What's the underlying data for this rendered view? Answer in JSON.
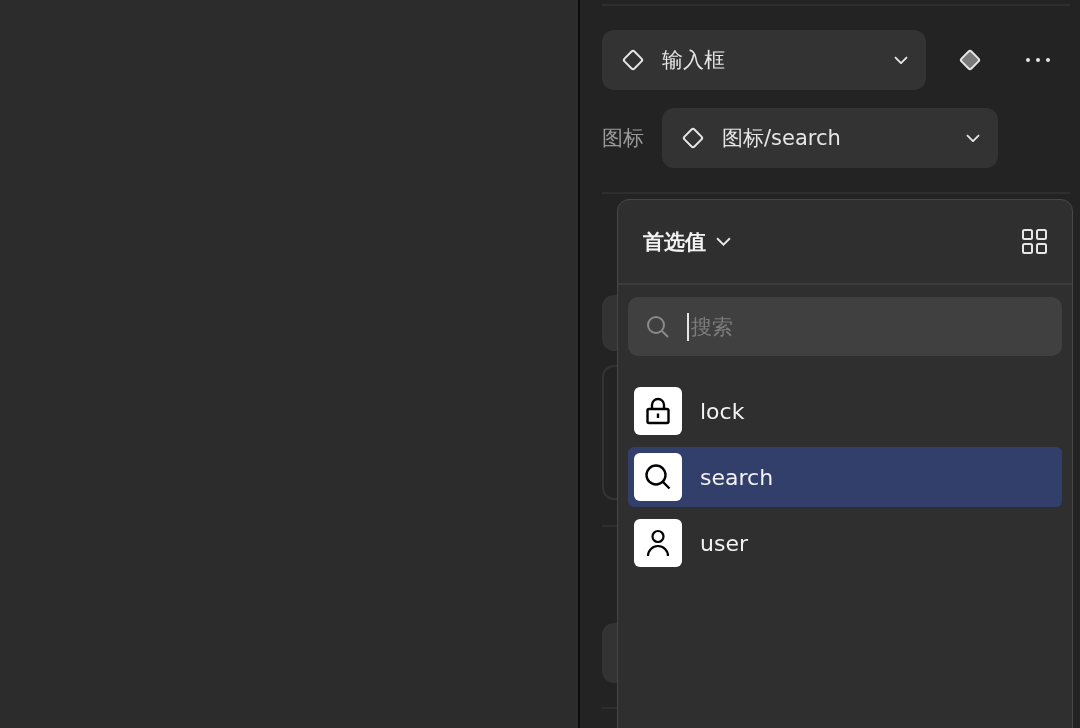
{
  "properties": {
    "component_select": {
      "value": "输入框"
    },
    "icon_field": {
      "label": "图标",
      "value": "图标/search"
    }
  },
  "icon_picker": {
    "library": "首选值",
    "search": {
      "placeholder": "搜索"
    },
    "items": [
      {
        "name": "lock",
        "kind": "lock",
        "selected": false
      },
      {
        "name": "search",
        "kind": "search",
        "selected": true
      },
      {
        "name": "user",
        "kind": "user",
        "selected": false
      }
    ]
  }
}
